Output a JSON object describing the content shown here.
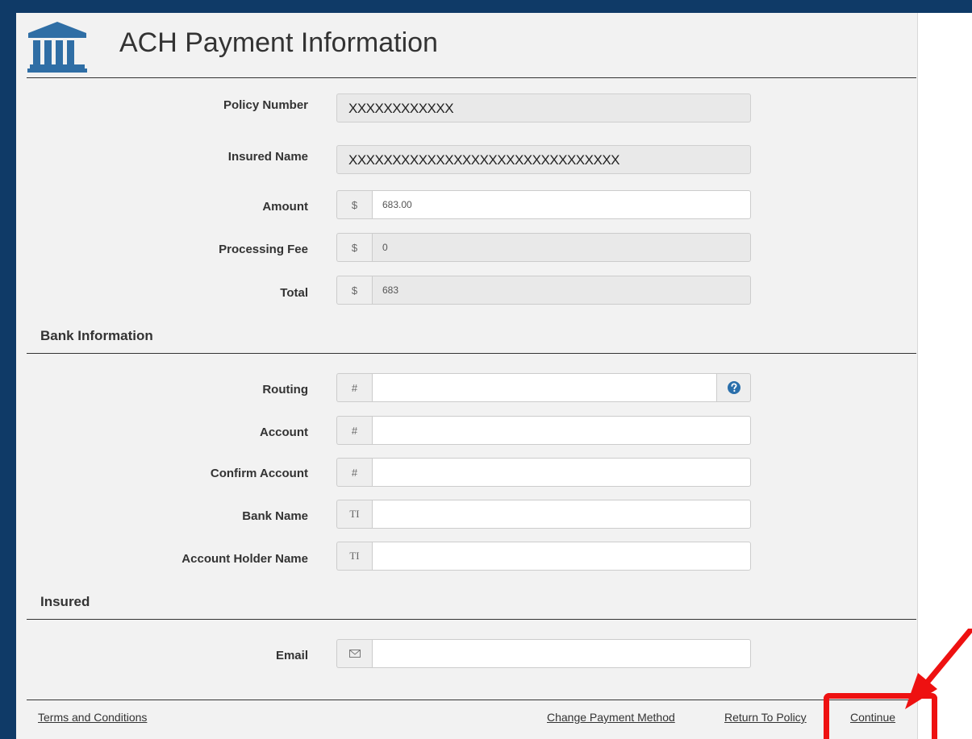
{
  "header": {
    "title": "ACH Payment Information",
    "icon": "bank-icon"
  },
  "policy": {
    "policy_number": {
      "label": "Policy Number",
      "value": "XXXXXXXXXXXX"
    },
    "insured_name": {
      "label": "Insured Name",
      "value": "XXXXXXXXXXXXXXXXXXXXXXXXXXXXXXX"
    },
    "amount": {
      "label": "Amount",
      "prefix": "$",
      "value": "683.00"
    },
    "processing_fee": {
      "label": "Processing Fee",
      "prefix": "$",
      "value": "0"
    },
    "total": {
      "label": "Total",
      "prefix": "$",
      "value": "683"
    }
  },
  "bank": {
    "heading": "Bank Information",
    "routing": {
      "label": "Routing",
      "prefix": "#",
      "help_icon": "question-circle-icon"
    },
    "account": {
      "label": "Account",
      "prefix": "#"
    },
    "confirm_account": {
      "label": "Confirm Account",
      "prefix": "#"
    },
    "bank_name": {
      "label": "Bank Name",
      "prefix": "TI"
    },
    "holder_name": {
      "label": "Account Holder Name",
      "prefix": "TI"
    }
  },
  "insured": {
    "heading": "Insured",
    "email": {
      "label": "Email",
      "icon": "envelope-icon"
    }
  },
  "footer": {
    "terms": "Terms and Conditions",
    "change_method": "Change Payment Method",
    "return_policy": "Return To Policy",
    "continue": "Continue"
  },
  "colors": {
    "frame": "#0f3a67",
    "accent": "#2a6fab",
    "highlight": "#ee1111"
  }
}
